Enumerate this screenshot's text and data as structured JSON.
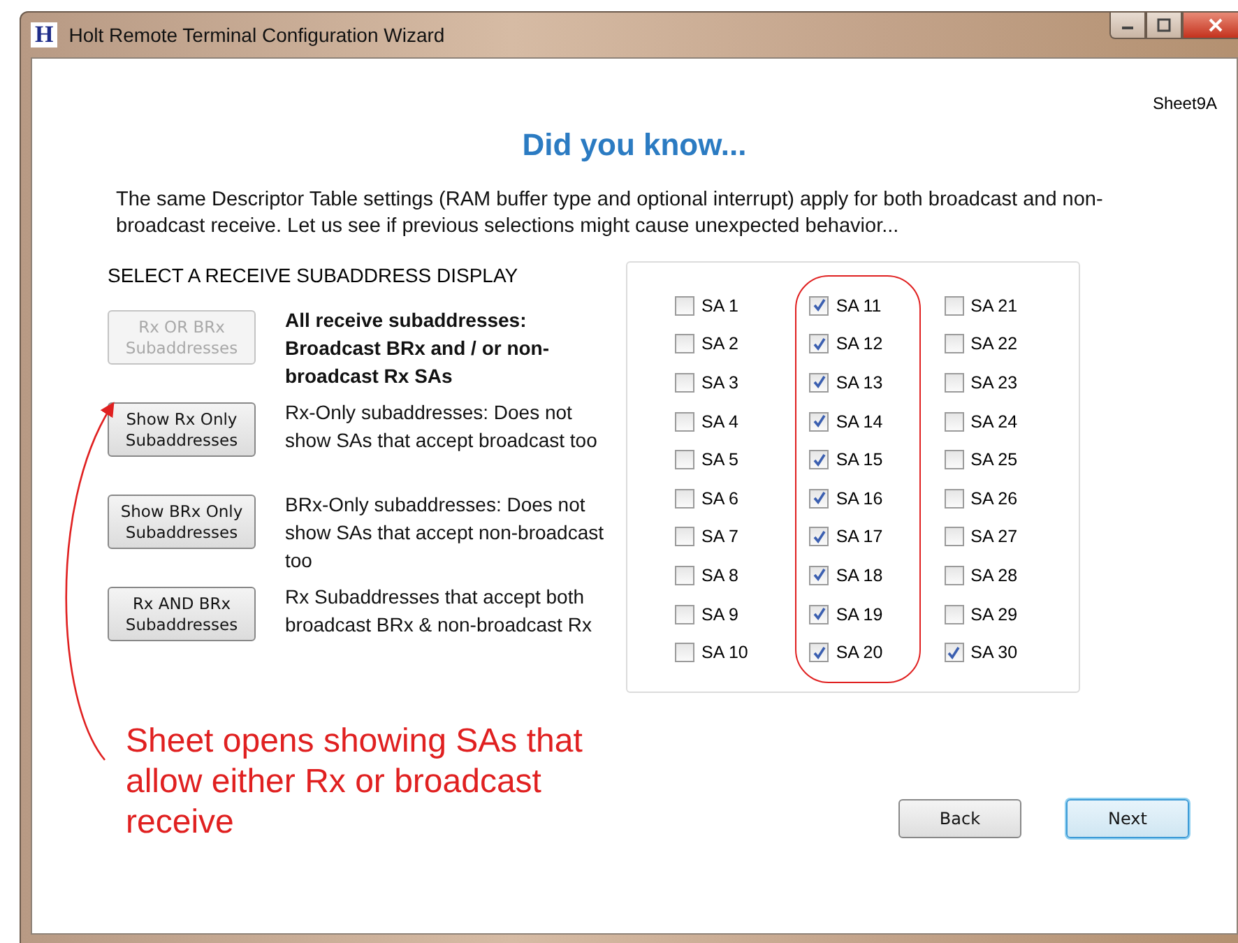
{
  "window": {
    "title": "Holt Remote Terminal Configuration Wizard",
    "logo": "H"
  },
  "sheet_label": "Sheet9A",
  "heading": "Did you know...",
  "intro": "The  same Descriptor Table settings (RAM buffer type and optional interrupt) apply for both broadcast and non-broadcast receive. Let us see if previous selections might cause unexpected  behavior...",
  "section_label": "SELECT A RECEIVE SUBADDRESS DISPLAY",
  "display_options": [
    {
      "button": "Rx OR BRx Subaddresses",
      "disabled": true,
      "description": "All receive subaddresses: Broadcast BRx and / or non-broadcast Rx SAs",
      "emphasized": true
    },
    {
      "button": "Show Rx Only Subaddresses",
      "disabled": false,
      "description": "Rx-Only subaddresses: Does not show SAs that accept broadcast too",
      "emphasized": false
    },
    {
      "button": "Show BRx Only Subaddresses",
      "disabled": false,
      "description": "BRx-Only subaddresses: Does not show SAs that accept non-broadcast too",
      "emphasized": false
    },
    {
      "button": "Rx AND BRx Subaddresses",
      "disabled": false,
      "description": "Rx Subaddresses that accept both broadcast BRx & non-broadcast Rx",
      "emphasized": false
    }
  ],
  "subaddresses": [
    {
      "label": "SA 1",
      "checked": false
    },
    {
      "label": "SA 2",
      "checked": false
    },
    {
      "label": "SA 3",
      "checked": false
    },
    {
      "label": "SA 4",
      "checked": false
    },
    {
      "label": "SA 5",
      "checked": false
    },
    {
      "label": "SA 6",
      "checked": false
    },
    {
      "label": "SA 7",
      "checked": false
    },
    {
      "label": "SA 8",
      "checked": false
    },
    {
      "label": "SA 9",
      "checked": false
    },
    {
      "label": "SA 10",
      "checked": false
    },
    {
      "label": "SA 11",
      "checked": true
    },
    {
      "label": "SA 12",
      "checked": true
    },
    {
      "label": "SA 13",
      "checked": true
    },
    {
      "label": "SA 14",
      "checked": true
    },
    {
      "label": "SA 15",
      "checked": true
    },
    {
      "label": "SA 16",
      "checked": true
    },
    {
      "label": "SA 17",
      "checked": true
    },
    {
      "label": "SA 18",
      "checked": true
    },
    {
      "label": "SA 19",
      "checked": true
    },
    {
      "label": "SA 20",
      "checked": true
    },
    {
      "label": "SA 21",
      "checked": false
    },
    {
      "label": "SA 22",
      "checked": false
    },
    {
      "label": "SA 23",
      "checked": false
    },
    {
      "label": "SA 24",
      "checked": false
    },
    {
      "label": "SA 25",
      "checked": false
    },
    {
      "label": "SA 26",
      "checked": false
    },
    {
      "label": "SA 27",
      "checked": false
    },
    {
      "label": "SA 28",
      "checked": false
    },
    {
      "label": "SA 29",
      "checked": false
    },
    {
      "label": "SA 30",
      "checked": true
    }
  ],
  "annotation": "Sheet opens showing SAs that allow either Rx or broadcast receive",
  "buttons": [
    {
      "label": "Back",
      "default": false
    },
    {
      "label": "Next",
      "default": true
    }
  ]
}
